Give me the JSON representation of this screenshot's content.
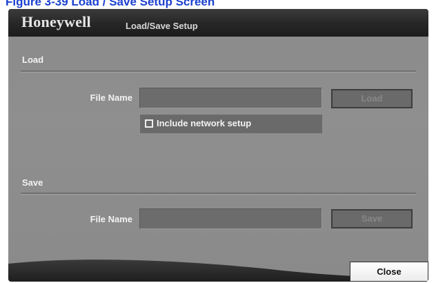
{
  "caption": "Figure 3-39    Load / Save Setup Screen",
  "window": {
    "brand": "Honeywell",
    "title": "Load/Save Setup"
  },
  "load": {
    "section_label": "Load",
    "file_name_label": "File Name",
    "file_name_value": "",
    "button_label": "Load",
    "include_network_label": "Include network setup",
    "include_network_checked": false
  },
  "save": {
    "section_label": "Save",
    "file_name_label": "File Name",
    "file_name_value": "",
    "button_label": "Save"
  },
  "close_label": "Close"
}
